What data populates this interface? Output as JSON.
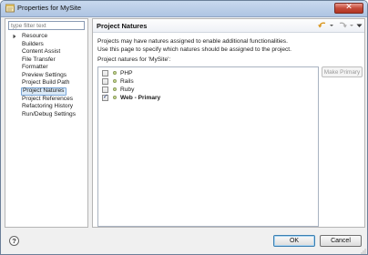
{
  "window": {
    "title": "Properties for MySite"
  },
  "filter": {
    "placeholder": "type filter text",
    "value": ""
  },
  "tree": {
    "items": [
      "Resource",
      "Builders",
      "Content Assist",
      "File Transfer",
      "Formatter",
      "Preview Settings",
      "Project Build Path",
      "Project Natures",
      "Project References",
      "Refactoring History",
      "Run/Debug Settings"
    ],
    "selected": "Project Natures"
  },
  "page": {
    "title": "Project Natures",
    "description_line1": "Projects may have natures assigned to enable additional functionalities.",
    "description_line2": "Use this page to specify which natures should be assigned to the project.",
    "natures_label": "Project natures for 'MySite':",
    "make_primary": "Make Primary"
  },
  "natures": [
    {
      "label": "PHP",
      "checked": false,
      "primary": false
    },
    {
      "label": "Rails",
      "checked": false,
      "primary": false
    },
    {
      "label": "Ruby",
      "checked": false,
      "primary": false
    },
    {
      "label": "Web - Primary",
      "checked": true,
      "primary": true
    }
  ],
  "buttons": {
    "ok": "OK",
    "cancel": "Cancel",
    "help": "?"
  },
  "icons": {
    "close": "close-icon",
    "back": "back-arrow-icon",
    "forward": "forward-arrow-icon",
    "menu": "view-menu-icon"
  },
  "colors": {
    "accent": "#3c7fb1",
    "selection": "#dbeaf8",
    "close": "#c44a3a"
  }
}
